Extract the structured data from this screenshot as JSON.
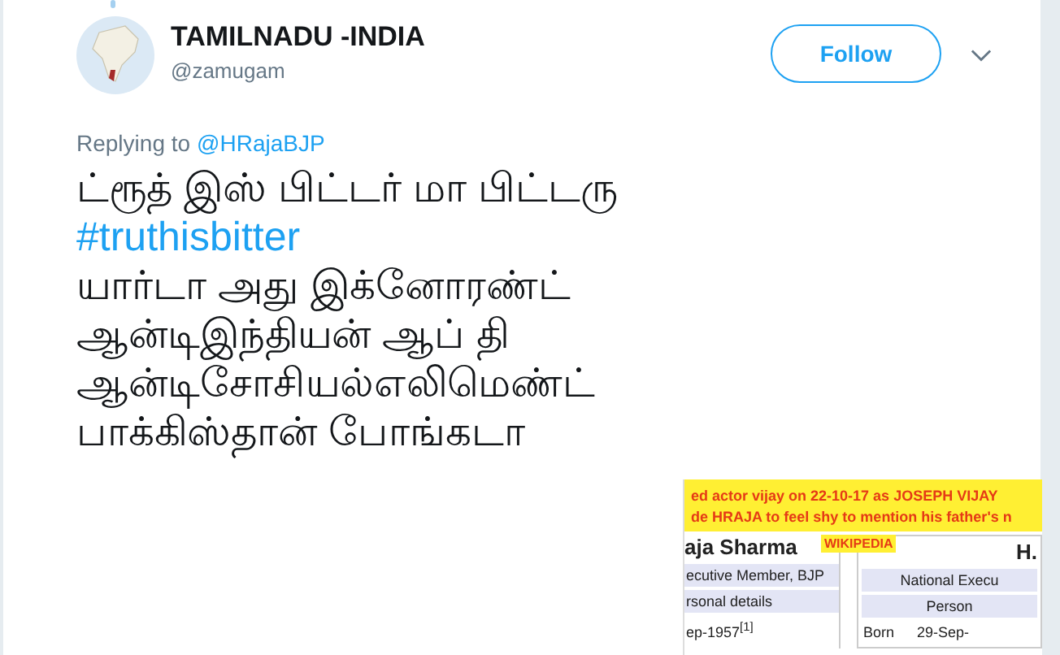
{
  "author": {
    "name": "TAMILNADU -INDIA",
    "handle": "@zamugam"
  },
  "follow_button": "Follow",
  "reply": {
    "label": "Replying to",
    "mention": "@HRajaBJP"
  },
  "tweet_lines": [
    {
      "kind": "text",
      "text": "ட்ரூத் இஸ் பிட்டர் மா பிட்டரு"
    },
    {
      "kind": "hashtag",
      "text": "#truthisbitter"
    },
    {
      "kind": "text",
      "text": "யார்டா அது இக்னோரண்ட்"
    },
    {
      "kind": "text",
      "text": "ஆன்டிஇந்தியன் ஆப் தி"
    },
    {
      "kind": "text",
      "text": "ஆன்டிசோசியல்எலிமெண்ட்"
    },
    {
      "kind": "text",
      "text": "பாக்கிஸ்தான் போங்கடா"
    }
  ],
  "attached_image": {
    "banner": [
      "ed actor vijay on 22-10-17 as JOSEPH VIJAY",
      "de HRAJA to feel shy to mention his father's n"
    ],
    "tag": "WIKIPEDIA",
    "left_panel": {
      "title": "aja Sharma",
      "rows": [
        {
          "kind": "header",
          "text": "ecutive Member, BJP"
        },
        {
          "kind": "header",
          "text": "rsonal details"
        },
        {
          "kind": "plain",
          "text": "ep-1957$^{[1]}$"
        }
      ]
    },
    "right_panel": {
      "title": "H.",
      "rows": [
        {
          "kind": "header",
          "text": "National Execu"
        },
        {
          "kind": "header",
          "text": "Person"
        },
        {
          "kind": "pair",
          "label": "Born",
          "text": "29-Sep-"
        }
      ]
    }
  }
}
